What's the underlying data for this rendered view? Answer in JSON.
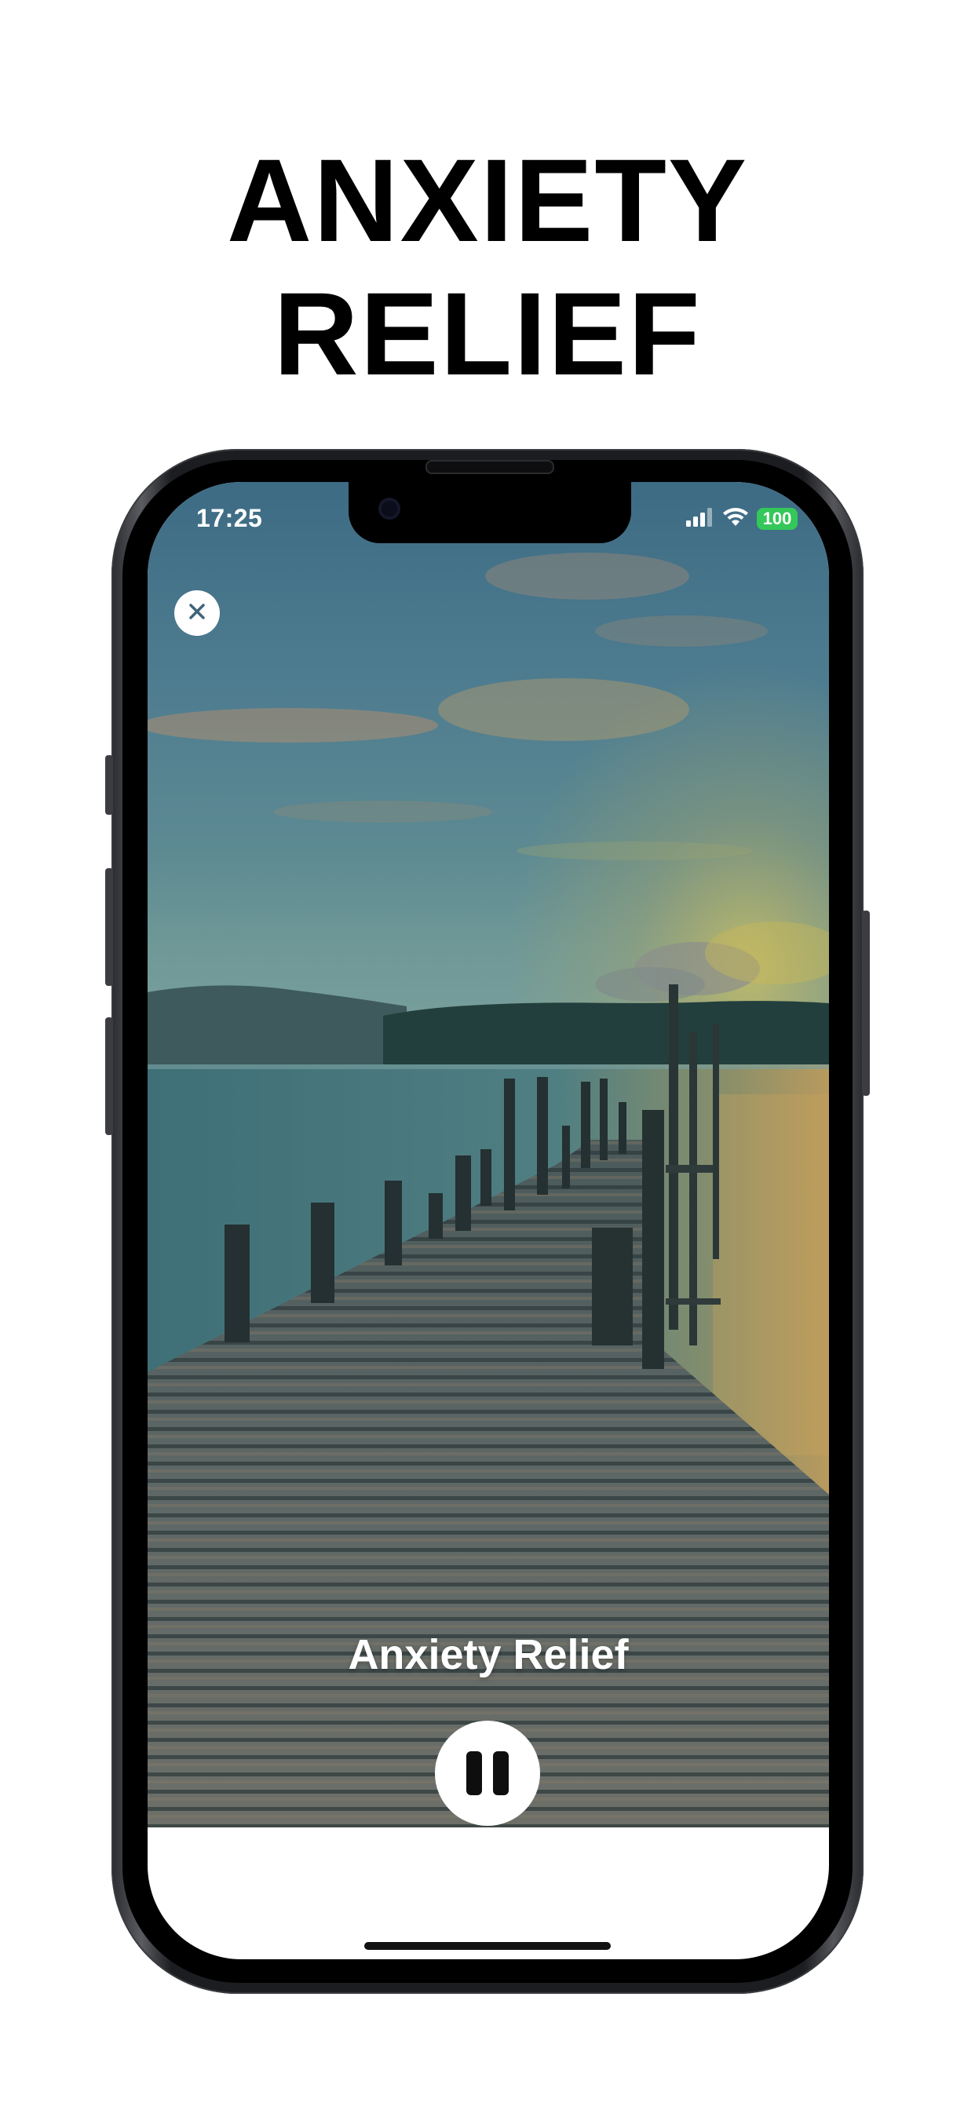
{
  "headline": "ANXIETY RELIEF",
  "status_bar": {
    "time": "17:25",
    "battery": "100",
    "battery_color": "#34c759",
    "signal_icon": "cellular-signal-icon",
    "wifi_icon": "wifi-icon"
  },
  "player": {
    "title": "Anxiety Relief",
    "close_icon": "close-icon",
    "pause_icon": "pause-icon",
    "background": "lake-pier-sunset-photo"
  }
}
